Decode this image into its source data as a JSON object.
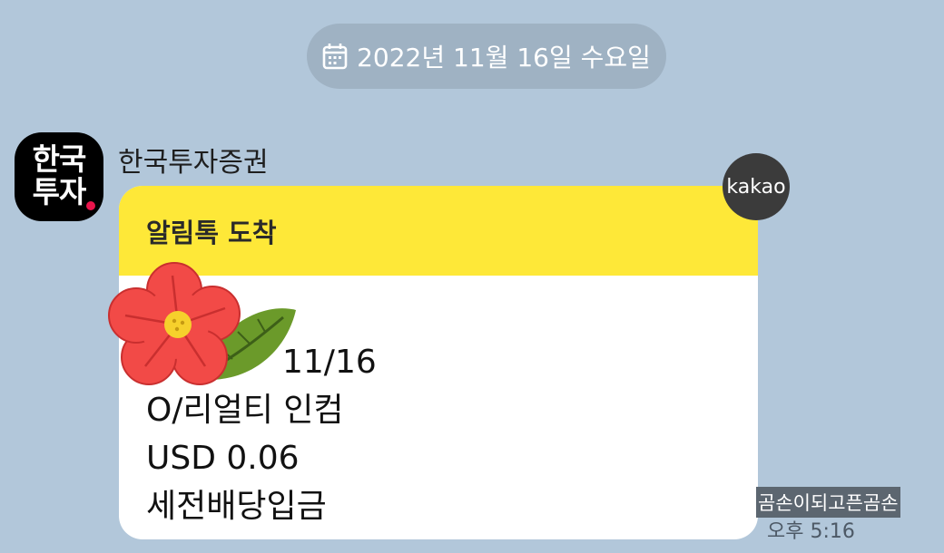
{
  "date_divider": {
    "icon": "calendar-icon",
    "text": "2022년 11월 16일 수요일"
  },
  "sender": {
    "avatar_text": "한국\n투자",
    "avatar_dot_color": "#e8144b",
    "name": "한국투자증권"
  },
  "message": {
    "header": "알림톡 도착",
    "header_color": "#fee838",
    "lines": [
      "",
      "11/16",
      "O/리얼티 인컴",
      "USD 0.06",
      "세전배당입금"
    ],
    "badge": "kakao",
    "time": "오후 5:16"
  },
  "sticker": {
    "icon": "flower-sticker-icon",
    "caption": "곰손이되고픈곰손"
  }
}
